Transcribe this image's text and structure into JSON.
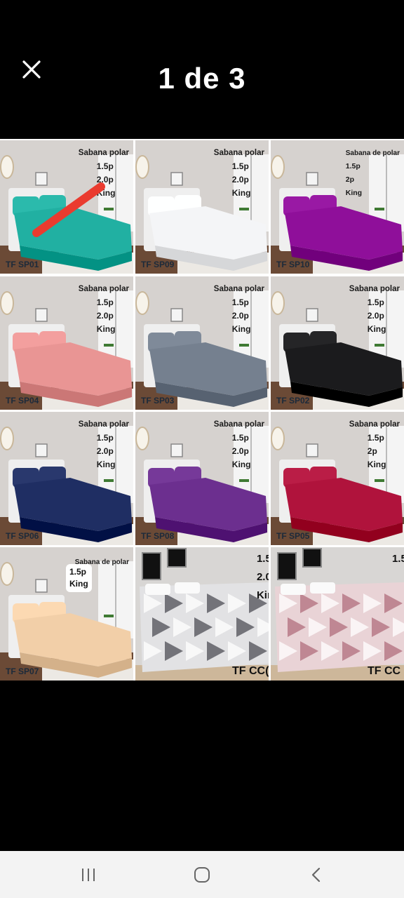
{
  "viewer": {
    "title": "1 de 3",
    "close_icon": "close-icon"
  },
  "colors": {
    "SP01": "#21b0a2",
    "SP09": "#f4f5f7",
    "SP10": "#8f0f9a",
    "SP04": "#e99594",
    "SP03": "#75808f",
    "SP02": "#1b1b1d",
    "SP06": "#1f2e63",
    "SP08": "#6c2f8f",
    "SP05": "#b0133c",
    "SP07": "#f2cfa8",
    "accent_mark": "#ea3b2f"
  },
  "tiles": [
    {
      "line1": "Sabana polar",
      "line2": "1.5p",
      "line3": "2.0p",
      "line4": "King",
      "code": "TF SP01"
    },
    {
      "line1": "Sabana polar",
      "line2": "1.5p",
      "line3": "2.0p",
      "line4": "King",
      "code": "TF SP09"
    },
    {
      "line1": "Sabana de polar",
      "line2": "1.5p",
      "line3": "2p",
      "line4": "King",
      "code": "TF SP10"
    },
    {
      "line1": "Sabana polar",
      "line2": "1.5p",
      "line3": "2.0p",
      "line4": "King",
      "code": "TF SP04"
    },
    {
      "line1": "Sabana polar",
      "line2": "1.5p",
      "line3": "2.0p",
      "line4": "King",
      "code": "TF SP03"
    },
    {
      "line1": "Sabana polar",
      "line2": "1.5p",
      "line3": "2.0p",
      "line4": "King",
      "code": "TF SP02"
    },
    {
      "line1": "Sabana polar",
      "line2": "1.5p",
      "line3": "2.0p",
      "line4": "King",
      "code": "TF SP06"
    },
    {
      "line1": "Sabana polar",
      "line2": "1.5p",
      "line3": "2.0p",
      "line4": "King",
      "code": "TF SP08"
    },
    {
      "line1": "Sabana polar",
      "line2": "1.5p",
      "line3": "2p",
      "line4": "King",
      "code": "TF SP05"
    },
    {
      "line1": "Sabana de polar",
      "badge1": "1.5p",
      "badge2": "King",
      "code": "TF SP07"
    },
    {
      "line1": "1.5|",
      "line2": "2.0",
      "line3": "Kin",
      "code": "TF CC("
    },
    {
      "line1": "1.5|",
      "code": "TF CC"
    }
  ],
  "navbar": {
    "recents_icon": "recent-apps-icon",
    "home_icon": "home-icon",
    "back_icon": "back-icon"
  }
}
